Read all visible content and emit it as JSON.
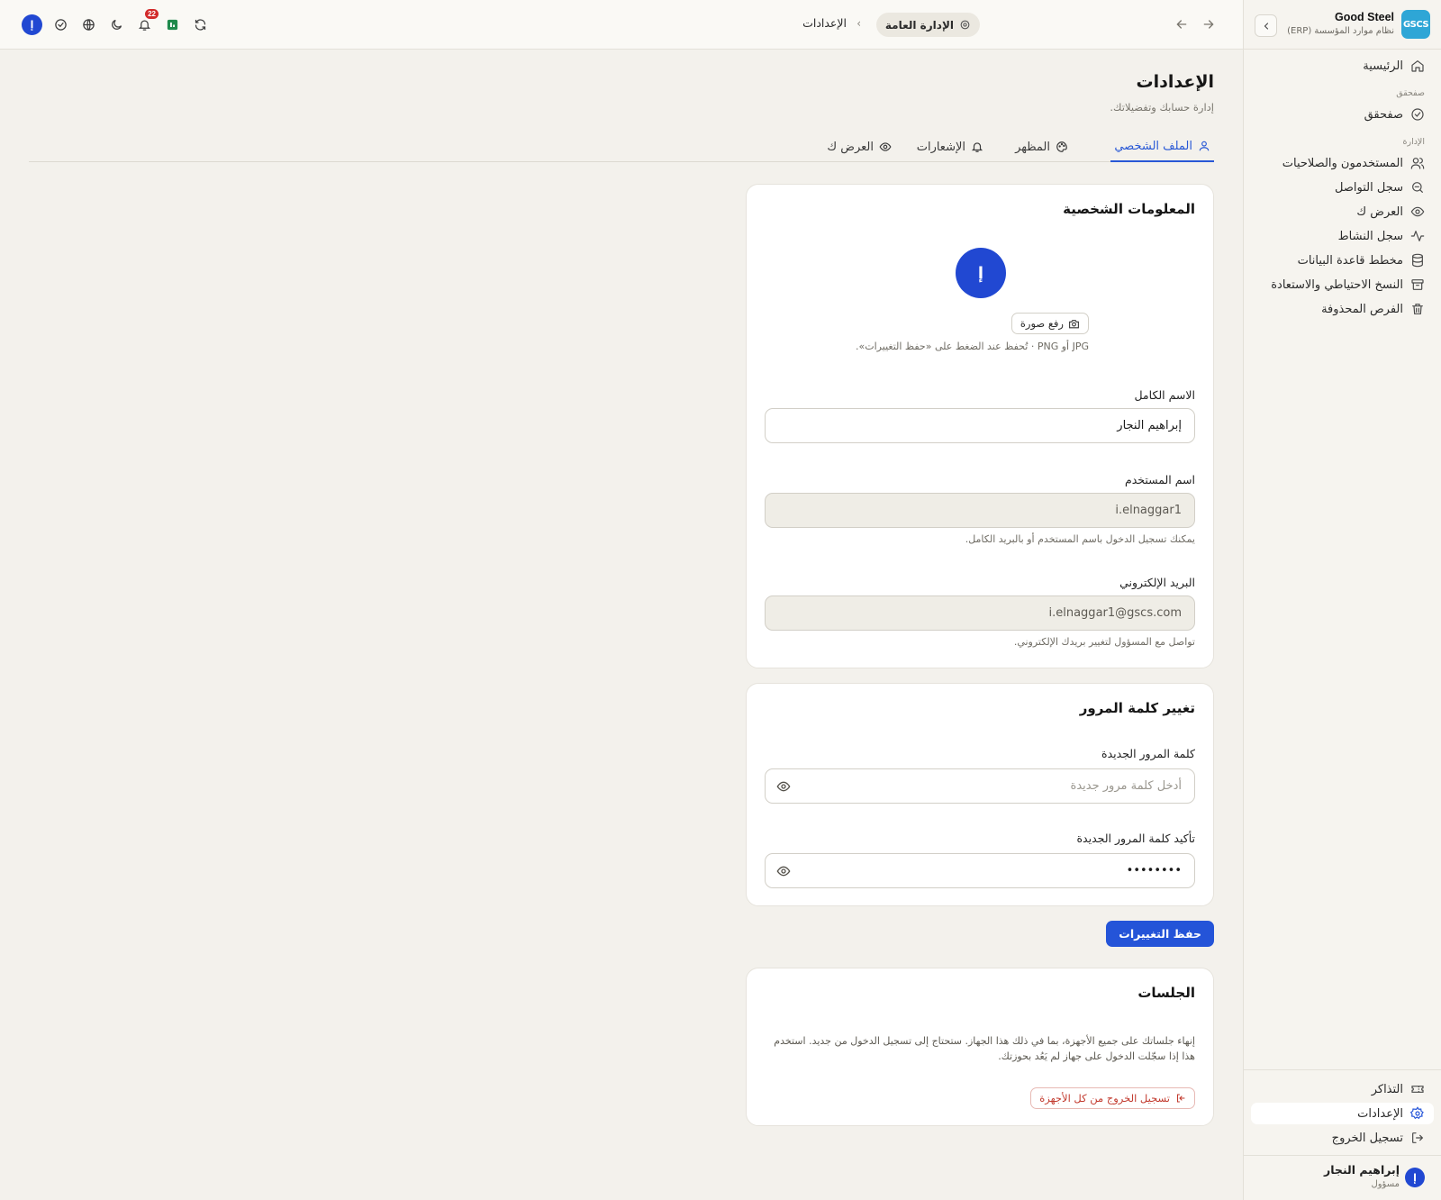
{
  "brand": {
    "logo_text": "GSCS",
    "name": "Good Steel",
    "subtitle": "نظام موارد المؤسسة (ERP)"
  },
  "sidebar": {
    "home": "الرئيسية",
    "section_checker": "صفحقق",
    "checker": "صفحقق",
    "section_admin": "الإدارة",
    "admin_items": [
      {
        "label": "المستخدمون والصلاحيات",
        "icon": "users-icon"
      },
      {
        "label": "سجل التواصل",
        "icon": "search-log-icon"
      },
      {
        "label": "العرض ك",
        "icon": "eye-icon"
      },
      {
        "label": "سجل النشاط",
        "icon": "activity-icon"
      },
      {
        "label": "مخطط قاعدة البيانات",
        "icon": "database-icon"
      },
      {
        "label": "النسخ الاحتياطي والاستعادة",
        "icon": "archive-icon"
      },
      {
        "label": "الفرص المحذوفة",
        "icon": "trash-icon"
      }
    ],
    "bottom": {
      "tickets": "التذاكر",
      "settings": "الإعدادات",
      "logout": "تسجيل الخروج"
    },
    "user": {
      "initial": "إ",
      "name": "إبراهيم النجار",
      "role": "مسؤول"
    }
  },
  "topbar": {
    "breadcrumb_section": "الإدارة العامة",
    "breadcrumb_sep": "›",
    "breadcrumb_current": "الإعدادات",
    "notifications_count": "22",
    "user_initial": "إ"
  },
  "page": {
    "title": "الإعدادات",
    "subtitle": "إدارة حسابك وتفضيلاتك."
  },
  "tabs": [
    {
      "label": "الملف الشخصي",
      "active": true
    },
    {
      "label": "المظهر",
      "active": false
    },
    {
      "label": "الإشعارات",
      "active": false
    },
    {
      "label": "العرض ك",
      "active": false
    }
  ],
  "profile_card": {
    "title": "المعلومات الشخصية",
    "avatar_initial": "إ",
    "upload_label": "رفع صورة",
    "upload_hint": "JPG أو PNG · تُحفظ عند الضغط على «حفظ التغييرات».",
    "full_name_label": "الاسم الكامل",
    "full_name_value": "إبراهيم النجار",
    "username_label": "اسم المستخدم",
    "username_value": "i.elnaggar1",
    "username_hint": "يمكنك تسجيل الدخول باسم المستخدم أو بالبريد الكامل.",
    "email_label": "البريد الإلكتروني",
    "email_value": "i.elnaggar1@gscs.com",
    "email_hint": "تواصل مع المسؤول لتغيير بريدك الإلكتروني."
  },
  "password_card": {
    "title": "تغيير كلمة المرور",
    "new_label": "كلمة المرور الجديدة",
    "new_placeholder": "أدخل كلمة مرور جديدة",
    "confirm_label": "تأكيد كلمة المرور الجديدة",
    "confirm_value": "••••••••"
  },
  "save_button": "حفظ التغييرات",
  "sessions_card": {
    "title": "الجلسات",
    "text": "إنهاء جلساتك على جميع الأجهزة، بما في ذلك هذا الجهاز. ستحتاج إلى تسجيل الدخول من جديد. استخدم هذا إذا سجّلت الدخول على جهاز لم يَعُد بحوزتك.",
    "signout_all": "تسجيل الخروج من كل الأجهزة"
  },
  "colors": {
    "accent": "#2454d8",
    "danger": "#c23a2e",
    "background": "#f3f1ec"
  }
}
